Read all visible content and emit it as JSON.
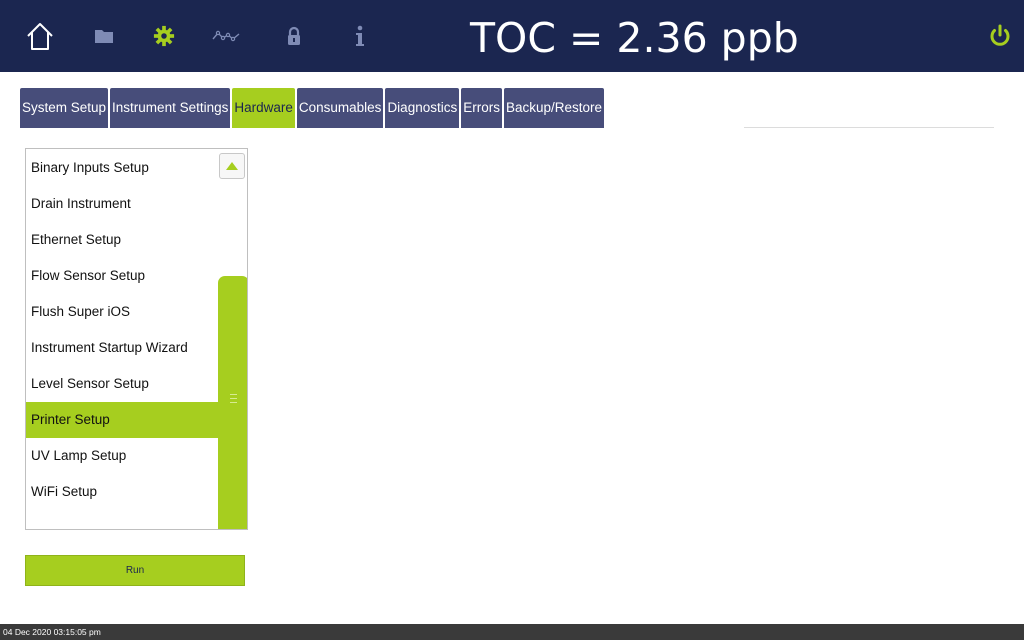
{
  "header": {
    "title": "TOC = 2.36 ppb",
    "icons": [
      "home-icon",
      "folder-icon",
      "gear-icon",
      "trend-icon",
      "lock-icon",
      "info-icon",
      "power-icon"
    ],
    "colors": {
      "background": "#1b2650",
      "accent": "#a6ce1f",
      "inactive": "#7f8bb5"
    }
  },
  "tabs": [
    {
      "label": "System Setup"
    },
    {
      "label": "Instrument Settings"
    },
    {
      "label": "Hardware",
      "active": true
    },
    {
      "label": "Consumables"
    },
    {
      "label": "Diagnostics"
    },
    {
      "label": "Errors"
    },
    {
      "label": "Backup/Restore"
    }
  ],
  "list": {
    "items": [
      {
        "label": "Binary Inputs Setup"
      },
      {
        "label": "Drain Instrument"
      },
      {
        "label": "Ethernet Setup"
      },
      {
        "label": "Flow Sensor Setup"
      },
      {
        "label": "Flush Super iOS"
      },
      {
        "label": "Instrument Startup Wizard"
      },
      {
        "label": "Level Sensor Setup"
      },
      {
        "label": "Printer Setup",
        "selected": true
      },
      {
        "label": "UV Lamp Setup"
      },
      {
        "label": "WiFi Setup"
      }
    ],
    "scroll_up_icon": "triangle-up-icon"
  },
  "run_label": "Run",
  "status": {
    "timestamp": "04 Dec 2020  03:15:05 pm"
  }
}
